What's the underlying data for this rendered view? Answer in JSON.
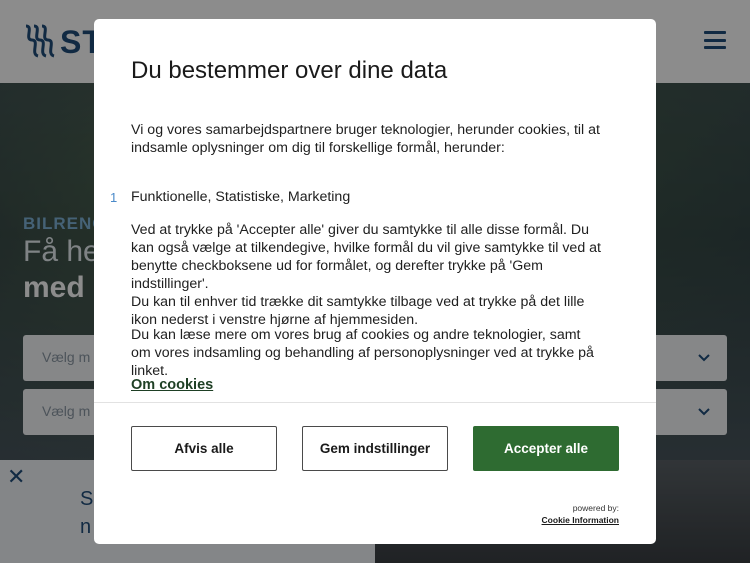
{
  "site": {
    "logo_text": "ST",
    "hero_kicker": "BILRENO",
    "hero_title_line1": "Få he",
    "hero_title_line2": "med",
    "select1_placeholder": "Vælg m",
    "select2_placeholder": "Vælg m",
    "promo_line1": "S",
    "promo_line2": "n",
    "close_symbol": "✕"
  },
  "consent": {
    "title": "Du bestemmer over dine data",
    "intro": "Vi og vores samarbejdspartnere bruger teknologier, herunder cookies, til at indsamle oplysninger om dig til forskellige formål, herunder:",
    "purpose_number": "1",
    "purposes": "Funktionelle, Statistiske, Marketing",
    "consent_text_1": "Ved at trykke på 'Accepter alle' giver du samtykke til alle disse formål. Du kan også vælge at tilkendegive, hvilke formål du vil give samtykke til ved at benytte checkboksene ud for formålet, og derefter trykke på 'Gem indstillinger'.",
    "consent_text_2": "Du kan til enhver tid trække dit samtykke tilbage ved at trykke på det lille ikon nederst i venstre hjørne af hjemmesiden.",
    "more_info": "Du kan læse mere om vores brug af cookies og andre teknologier, samt om vores indsamling og behandling af personoplysninger ved at trykke på linket.",
    "link_label": "Om cookies",
    "buttons": {
      "reject": "Afvis alle",
      "save": "Gem indstillinger",
      "accept": "Accepter alle"
    },
    "powered_by": "powered by:",
    "provider": "Cookie Information"
  },
  "colors": {
    "accept_button": "#2e6b31",
    "brand_blue": "#1f4d7a",
    "link": "#1e3f24"
  },
  "icons": [
    "logo-icon",
    "hamburger-menu-icon",
    "chevron-down-icon",
    "close-icon"
  ]
}
